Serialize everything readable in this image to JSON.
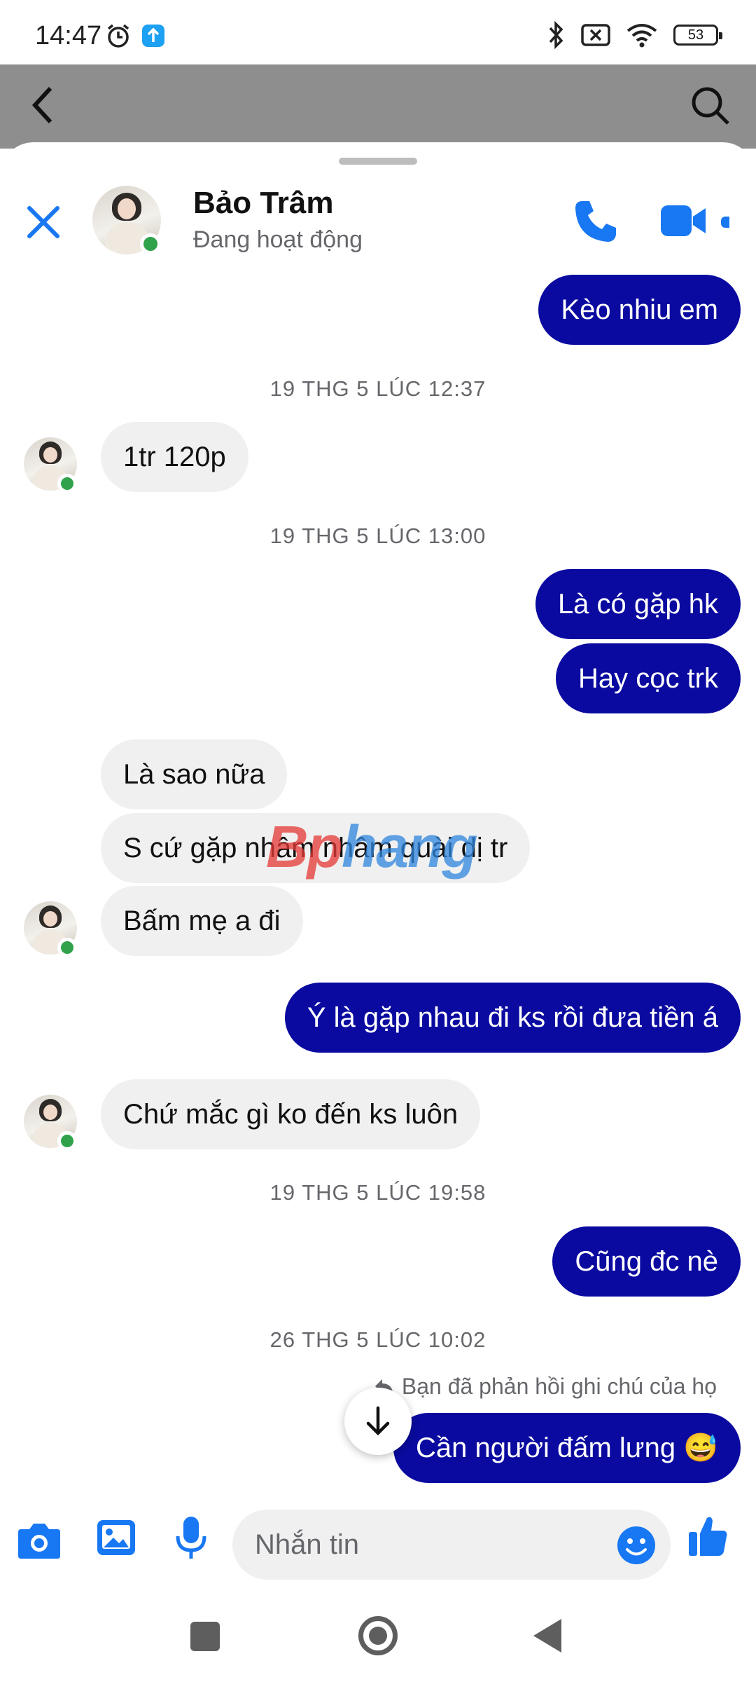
{
  "status_bar": {
    "time": "14:47",
    "battery": "53",
    "icons": [
      "alarm-icon",
      "upload-icon",
      "bluetooth-icon",
      "no-sim-icon",
      "wifi-icon",
      "battery-icon"
    ]
  },
  "contact": {
    "name": "Bảo Trâm",
    "status": "Đang hoạt động"
  },
  "messages": [
    {
      "dir": "out",
      "text": "Kèo nhiu em"
    },
    {
      "stamp": "19 THG 5 LÚC 12:37"
    },
    {
      "dir": "in",
      "text": "1tr 120p"
    },
    {
      "stamp": "19 THG 5 LÚC 13:00"
    },
    {
      "dir": "out",
      "text": "Là có gặp hk"
    },
    {
      "dir": "out",
      "text": "Hay cọc trk"
    },
    {
      "dir": "in",
      "text": "Là sao nữa"
    },
    {
      "dir": "in",
      "text": "S cứ gặp nhâm nhâm quài dị tr"
    },
    {
      "dir": "in",
      "text": "Bấm mẹ a đi"
    },
    {
      "dir": "out",
      "text": "Ý là gặp nhau đi ks rồi đưa tiền á"
    },
    {
      "dir": "in",
      "text": "Chứ mắc gì ko đến ks luôn"
    },
    {
      "stamp": "19 THG 5 LÚC 19:58"
    },
    {
      "dir": "out",
      "text": "Cũng đc nè"
    },
    {
      "stamp": "26 THG 5 LÚC 10:02"
    },
    {
      "dir": "out",
      "text": "Cần người đấm lưng 😅"
    }
  ],
  "reply_note": "Bạn đã phản hồi ghi chú của họ",
  "watermark": {
    "part1": "Bp",
    "part2": "hang"
  },
  "composer": {
    "placeholder": "Nhắn tin"
  },
  "colors": {
    "outgoing_bubble": "#0a0aa0",
    "incoming_bubble": "#f0f0f0",
    "accent": "#1877f2",
    "online": "#31a24c"
  }
}
